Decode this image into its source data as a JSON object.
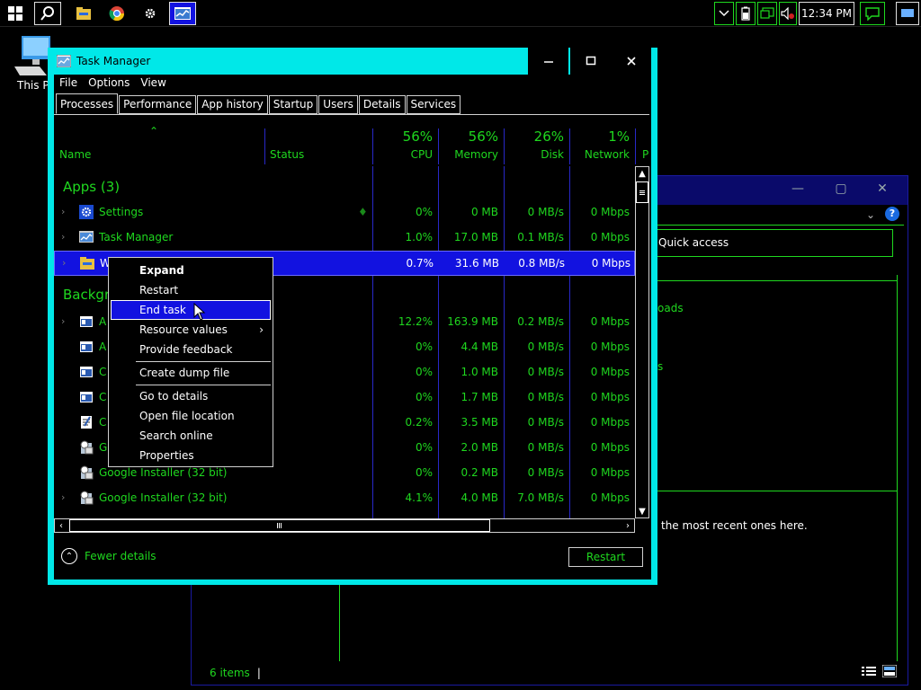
{
  "taskbar": {
    "clock": "12:34 PM",
    "icons": [
      "windows-start-icon",
      "search-icon",
      "file-explorer-icon",
      "chrome-icon",
      "settings-icon",
      "task-manager-icon"
    ],
    "tray_icons": [
      "chevron-down-icon",
      "battery-icon",
      "network-icon",
      "volume-muted-icon",
      "notification-icon",
      "show-desktop"
    ]
  },
  "desktop": {
    "icon_label": "This PC"
  },
  "explorer": {
    "quick_access": "Quick access",
    "partial_texts": [
      "oads",
      "s"
    ],
    "recent_hint": "the most recent ones here.",
    "status_items": "6 items"
  },
  "task_manager": {
    "title": "Task Manager",
    "menu": [
      "File",
      "Options",
      "View"
    ],
    "tabs": [
      "Processes",
      "Performance",
      "App history",
      "Startup",
      "Users",
      "Details",
      "Services"
    ],
    "columns": {
      "name": "Name",
      "status": "Status",
      "cpu_pct": "56%",
      "cpu": "CPU",
      "memory_pct": "56%",
      "memory": "Memory",
      "disk_pct": "26%",
      "disk": "Disk",
      "network_pct": "1%",
      "network": "Network",
      "power_partial": "P"
    },
    "groups": {
      "apps": "Apps (3)",
      "background": "Backgro"
    },
    "rows": [
      {
        "name": "Settings",
        "cpu": "0%",
        "mem": "0 MB",
        "disk": "0 MB/s",
        "net": "0 Mbps"
      },
      {
        "name": "Task Manager",
        "cpu": "1.0%",
        "mem": "17.0 MB",
        "disk": "0.1 MB/s",
        "net": "0 Mbps"
      },
      {
        "name": "W",
        "cpu": "0.7%",
        "mem": "31.6 MB",
        "disk": "0.8 MB/s",
        "net": "0 Mbps"
      },
      {
        "name": "A",
        "cpu": "12.2%",
        "mem": "163.9 MB",
        "disk": "0.2 MB/s",
        "net": "0 Mbps"
      },
      {
        "name": "A",
        "cpu": "0%",
        "mem": "4.4 MB",
        "disk": "0 MB/s",
        "net": "0 Mbps"
      },
      {
        "name": "C",
        "cpu": "0%",
        "mem": "1.0 MB",
        "disk": "0 MB/s",
        "net": "0 Mbps"
      },
      {
        "name": "C",
        "cpu": "0%",
        "mem": "1.7 MB",
        "disk": "0 MB/s",
        "net": "0 Mbps"
      },
      {
        "name": "C",
        "cpu": "0.2%",
        "mem": "3.5 MB",
        "disk": "0 MB/s",
        "net": "0 Mbps"
      },
      {
        "name": "G",
        "cpu": "0%",
        "mem": "2.0 MB",
        "disk": "0 MB/s",
        "net": "0 Mbps"
      },
      {
        "name": "Google Installer (32 bit)",
        "cpu": "0%",
        "mem": "0.2 MB",
        "disk": "0 MB/s",
        "net": "0 Mbps"
      },
      {
        "name": "Google Installer (32 bit)",
        "cpu": "4.1%",
        "mem": "4.0 MB",
        "disk": "7.0 MB/s",
        "net": "0 Mbps"
      }
    ],
    "fewer_details": "Fewer details",
    "restart_button": "Restart"
  },
  "context_menu": {
    "items": [
      "Expand",
      "Restart",
      "End task",
      "Resource values",
      "Provide feedback",
      "Create dump file",
      "Go to details",
      "Open file location",
      "Search online",
      "Properties"
    ],
    "highlighted": "End task"
  },
  "colors": {
    "accent": "#00e8e8",
    "text_green": "#1fd81f",
    "selection": "#1212e0",
    "divider": "#2828c8"
  }
}
